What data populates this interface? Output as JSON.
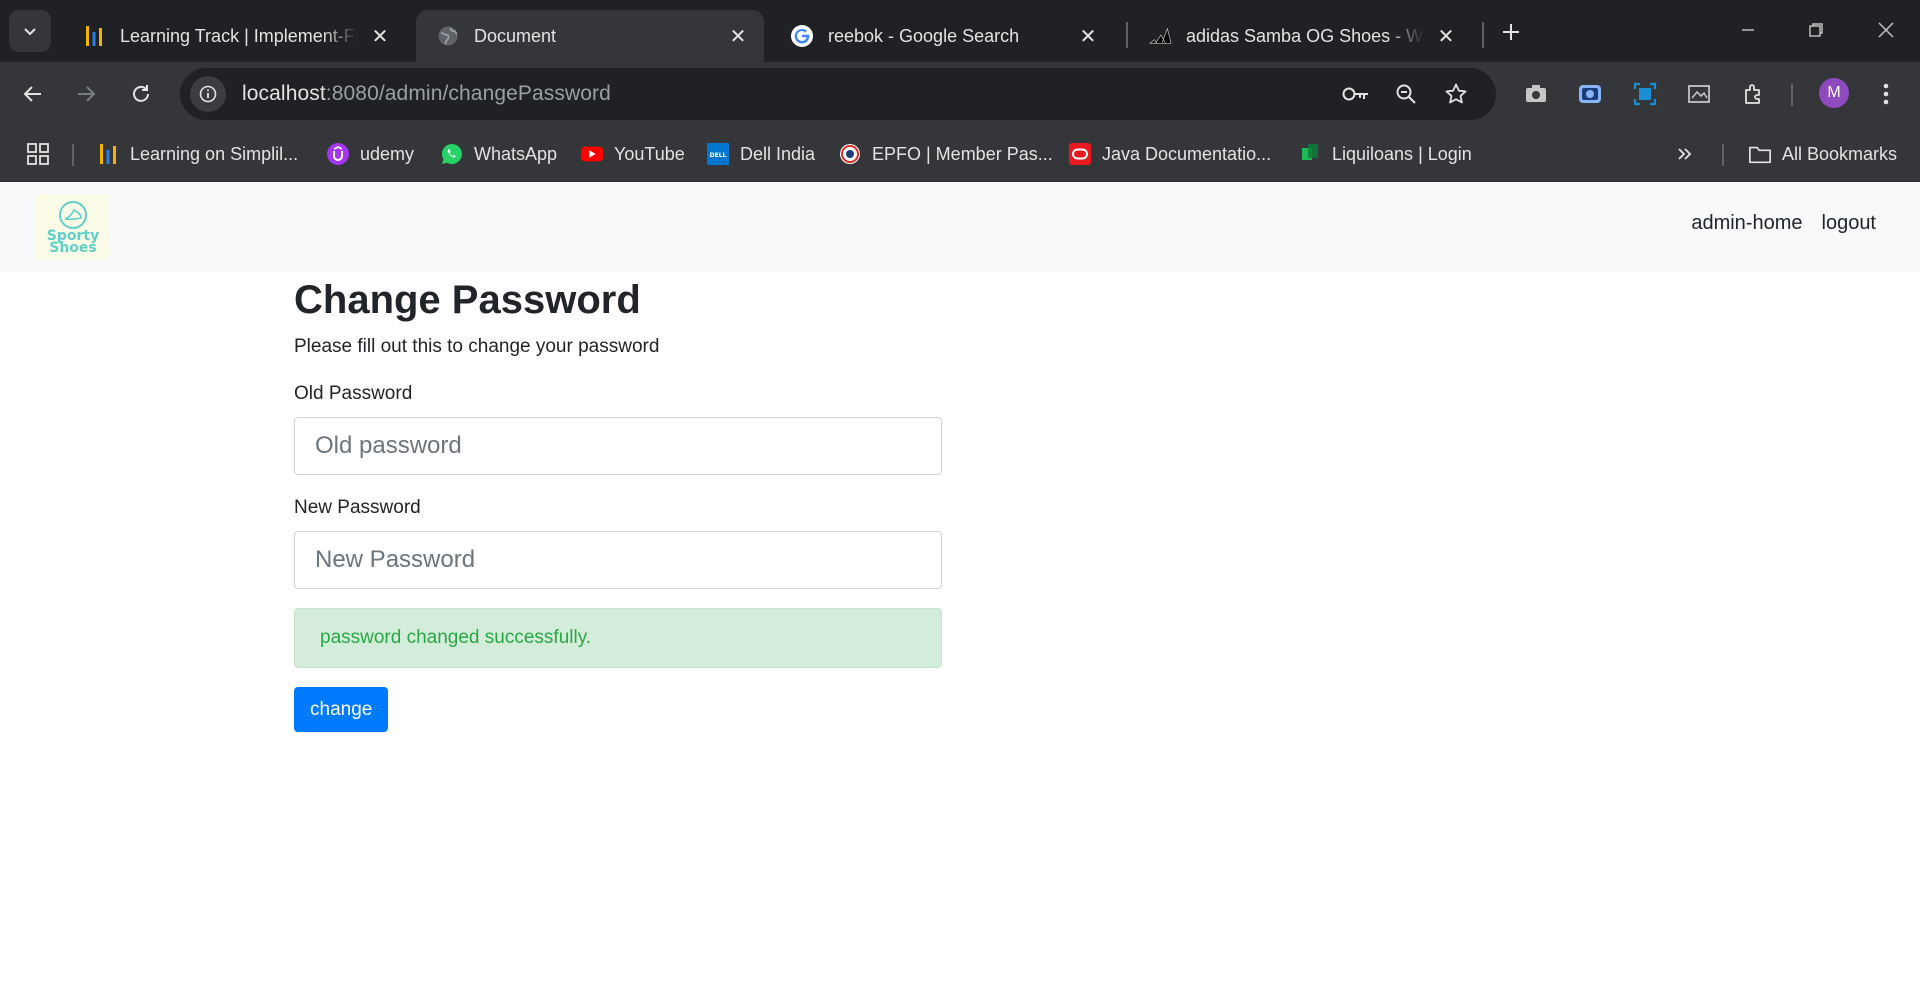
{
  "browser": {
    "tabs": [
      {
        "title": "Learning Track | Implement-Framew",
        "favicon": "simplilearn-icon"
      },
      {
        "title": "Document",
        "favicon": "globe-icon",
        "active": true
      },
      {
        "title": "reebok - Google Search",
        "favicon": "google-icon"
      },
      {
        "title": "adidas Samba OG Shoes - White",
        "favicon": "adidas-icon"
      }
    ],
    "url_host": "localhost",
    "url_path": ":8080/admin/changePassword",
    "profile_initial": "M",
    "bookmarks": [
      {
        "label": "Learning on Simplil...",
        "icon": "simplilearn-icon"
      },
      {
        "label": "udemy",
        "icon": "udemy-icon"
      },
      {
        "label": "WhatsApp",
        "icon": "whatsapp-icon"
      },
      {
        "label": "YouTube",
        "icon": "youtube-icon"
      },
      {
        "label": "Dell India",
        "icon": "dell-icon"
      },
      {
        "label": "EPFO | Member Pas...",
        "icon": "epfo-icon"
      },
      {
        "label": "Java Documentatio...",
        "icon": "oracle-icon"
      },
      {
        "label": "Liquiloans | Login",
        "icon": "liquiloans-icon"
      }
    ],
    "all_bookmarks_label": "All Bookmarks"
  },
  "navbar": {
    "logo_line1": "Sporty",
    "logo_line2": "Shoes",
    "links": [
      "admin-home",
      "logout"
    ]
  },
  "form": {
    "title": "Change Password",
    "subtitle": "Please fill out this to change your password",
    "old_label": "Old Password",
    "old_placeholder": "Old password",
    "new_label": "New Password",
    "new_placeholder": "New Password",
    "alert": "password changed successfully.",
    "submit_label": "change"
  },
  "colors": {
    "primary": "#007bff",
    "success_text": "#28a745",
    "success_bg": "#d4edda",
    "navbar_bg": "#f8f9fa",
    "chrome_dark": "#202124",
    "chrome_toolbar": "#35363a"
  }
}
